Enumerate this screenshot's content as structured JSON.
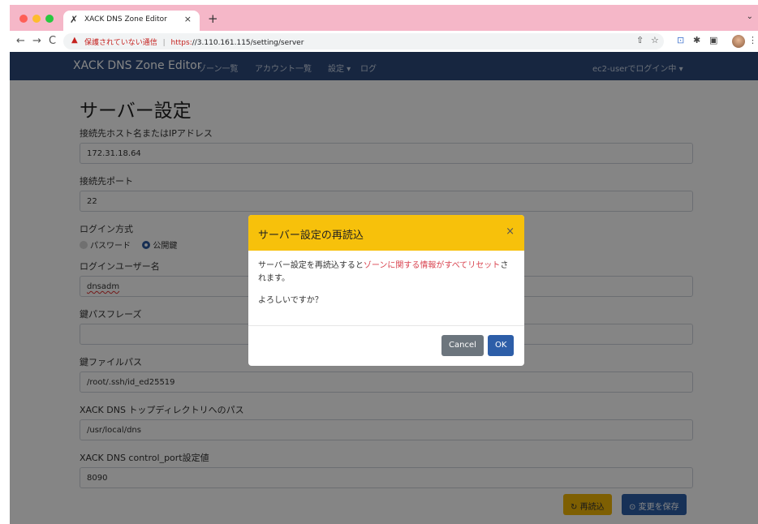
{
  "browser": {
    "tab_title": "XACK DNS Zone Editor",
    "tab_close": "×",
    "new_tab": "+",
    "security_warning": "保護されていない通信",
    "url_scheme": "https:",
    "url_rest": "//3.110.161.115/setting/server"
  },
  "app": {
    "brand": "XACK DNS Zone Editor",
    "nav": {
      "zones": "ゾーン一覧",
      "accounts": "アカウント一覧",
      "settings": "設定 ▾",
      "logs": "ログ",
      "user": "ec2-userでログイン中 ▾"
    }
  },
  "form": {
    "title": "サーバー設定",
    "host_label": "接続先ホスト名またはIPアドレス",
    "host_value": "172.31.18.64",
    "port_label": "接続先ポート",
    "port_value": "22",
    "login_method_label": "ログイン方式",
    "login_method_password": "パスワード",
    "login_method_pubkey": "公開鍵",
    "login_user_label": "ログインユーザー名",
    "login_user_value": "dnsadm",
    "passphrase_label": "鍵パスフレーズ",
    "passphrase_value": "",
    "keyfile_label": "鍵ファイルパス",
    "keyfile_value": "/root/.ssh/id_ed25519",
    "topdir_label": "XACK DNS トップディレクトリへのパス",
    "topdir_value": "/usr/local/dns",
    "control_port_label": "XACK DNS control_port設定値",
    "control_port_value": "8090",
    "reload_button": "再読込",
    "save_button": "変更を保存"
  },
  "modal": {
    "title": "サーバー設定の再読込",
    "close": "×",
    "body_prefix": "サーバー設定を再読込すると",
    "body_danger": "ゾーンに関する情報がすべてリセット",
    "body_suffix": "されます。",
    "question": "よろしいですか？",
    "cancel": "Cancel",
    "ok": "OK"
  },
  "colors": {
    "navbar": "#2c4a7c",
    "modal_header": "#f7c10b",
    "primary": "#2d5ea8",
    "warning": "#f2b705",
    "danger_text": "#d9434f"
  }
}
